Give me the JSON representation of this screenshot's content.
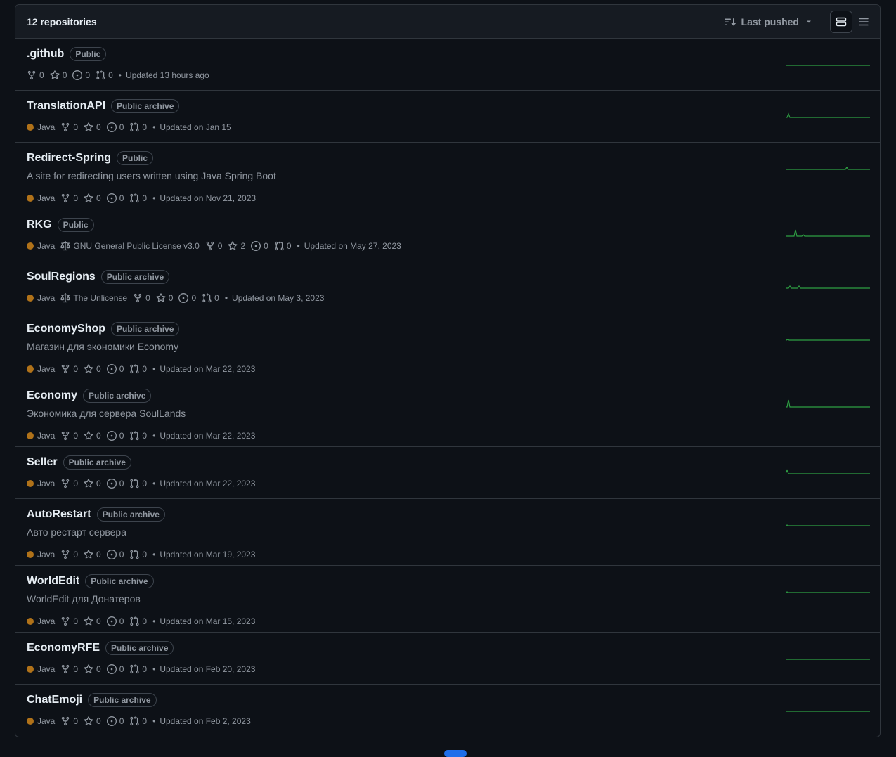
{
  "header": {
    "count_label": "12 repositories",
    "sort_label": "Last pushed"
  },
  "colors": {
    "java": "#b07219",
    "spark": "#2ea043"
  },
  "repos": [
    {
      "name": ".github",
      "badge": "Public",
      "description": "",
      "language": "",
      "license": "",
      "forks": "0",
      "stars": "0",
      "issues": "0",
      "prs": "0",
      "updated": "Updated 13 hours ago"
    },
    {
      "name": "TranslationAPI",
      "badge": "Public archive",
      "description": "",
      "language": "Java",
      "license": "",
      "forks": "0",
      "stars": "0",
      "issues": "0",
      "prs": "0",
      "updated": "Updated on Jan 15"
    },
    {
      "name": "Redirect-Spring",
      "badge": "Public",
      "description": "A site for redirecting users written using Java Spring Boot",
      "language": "Java",
      "license": "",
      "forks": "0",
      "stars": "0",
      "issues": "0",
      "prs": "0",
      "updated": "Updated on Nov 21, 2023"
    },
    {
      "name": "RKG",
      "badge": "Public",
      "description": "",
      "language": "Java",
      "license": "GNU General Public License v3.0",
      "forks": "0",
      "stars": "2",
      "issues": "0",
      "prs": "0",
      "updated": "Updated on May 27, 2023"
    },
    {
      "name": "SoulRegions",
      "badge": "Public archive",
      "description": "",
      "language": "Java",
      "license": "The Unlicense",
      "forks": "0",
      "stars": "0",
      "issues": "0",
      "prs": "0",
      "updated": "Updated on May 3, 2023"
    },
    {
      "name": "EconomyShop",
      "badge": "Public archive",
      "description": "Магазин для экономики Economy",
      "language": "Java",
      "license": "",
      "forks": "0",
      "stars": "0",
      "issues": "0",
      "prs": "0",
      "updated": "Updated on Mar 22, 2023"
    },
    {
      "name": "Economy",
      "badge": "Public archive",
      "description": "Экономика для сервера SoulLands",
      "language": "Java",
      "license": "",
      "forks": "0",
      "stars": "0",
      "issues": "0",
      "prs": "0",
      "updated": "Updated on Mar 22, 2023"
    },
    {
      "name": "Seller",
      "badge": "Public archive",
      "description": "",
      "language": "Java",
      "license": "",
      "forks": "0",
      "stars": "0",
      "issues": "0",
      "prs": "0",
      "updated": "Updated on Mar 22, 2023"
    },
    {
      "name": "AutoRestart",
      "badge": "Public archive",
      "description": "Авто рестарт сервера",
      "language": "Java",
      "license": "",
      "forks": "0",
      "stars": "0",
      "issues": "0",
      "prs": "0",
      "updated": "Updated on Mar 19, 2023"
    },
    {
      "name": "WorldEdit",
      "badge": "Public archive",
      "description": "WorldEdit для Донатеров",
      "language": "Java",
      "license": "",
      "forks": "0",
      "stars": "0",
      "issues": "0",
      "prs": "0",
      "updated": "Updated on Mar 15, 2023"
    },
    {
      "name": "EconomyRFE",
      "badge": "Public archive",
      "description": "",
      "language": "Java",
      "license": "",
      "forks": "0",
      "stars": "0",
      "issues": "0",
      "prs": "0",
      "updated": "Updated on Feb 20, 2023"
    },
    {
      "name": "ChatEmoji",
      "badge": "Public archive",
      "description": "",
      "language": "Java",
      "license": "",
      "forks": "0",
      "stars": "0",
      "issues": "0",
      "prs": "0",
      "updated": "Updated on Feb 2, 2023"
    }
  ],
  "icons": {
    "sort": "sort-icon",
    "caret": "triangle-down-icon",
    "view_detailed": "rows-icon",
    "view_compact": "list-icon",
    "fork": "repo-forked-icon",
    "star": "star-icon",
    "issue": "issue-opened-icon",
    "pr": "git-pull-request-icon",
    "license": "law-icon"
  }
}
